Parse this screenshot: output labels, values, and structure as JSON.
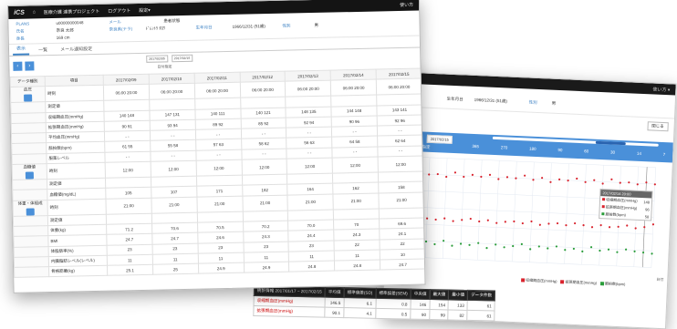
{
  "front": {
    "nav": {
      "logo": "iCS",
      "home_icon": "home-icon",
      "items": [
        "医療介護 連携プロジェクト",
        "ログアウト",
        "設定▾"
      ],
      "right": "使い方"
    },
    "patient": {
      "id_label": "PLANS",
      "id_value": "u00000000048",
      "name_label": "氏名",
      "name_value": "奈良 太郎",
      "h_label": "身長",
      "h_value": "169 cm",
      "kana_label": "メール",
      "kana_value": "奈良県(ナラ)",
      "kana2": "ﾄﾞﾚﾝﾄｳ ﾀﾛｳ",
      "status_label": "患者状態",
      "birth_label": "生年月日",
      "birth_value": "1966/12/31 (51歳)",
      "sex_label": "性別",
      "sex_value": "男"
    },
    "tabs": [
      "表示",
      "一覧",
      "メール通知設定"
    ],
    "ctrl": {
      "dates": [
        "2017/02/05",
        "2017/02/15"
      ],
      "caption": "日付指定"
    },
    "table": {
      "headers": [
        "データ種別",
        "項目",
        "2017/02/09",
        "2017/02/10",
        "2017/02/11",
        "2017/02/12",
        "2017/02/13",
        "2017/02/14",
        "2017/02/15"
      ],
      "rows": [
        {
          "sec": "血圧",
          "item": "時刻",
          "vals": [
            "06:00 20:00",
            "06:00 20:00",
            "06:00 20:00",
            "06:00 20:00",
            "06:00 20:00",
            "06:00 20:00",
            "06:00 20:00"
          ]
        },
        {
          "sec": "",
          "item": "測定値",
          "vals": [
            "",
            "",
            "",
            "",
            "",
            "",
            ""
          ]
        },
        {
          "sec": "",
          "item": "収縮期血圧(mmHg)",
          "vals": [
            "140 148",
            "147 131",
            "140 111",
            "140 121",
            "148 135",
            "144 148",
            "143 141"
          ]
        },
        {
          "sec": "",
          "item": "拡張期血圧(mmHg)",
          "vals": [
            "90 91",
            "93 94",
            "89 92",
            "85 92",
            "92 94",
            "90 96",
            "92 96"
          ]
        },
        {
          "sec": "",
          "item": "平均血圧(mmHg)",
          "vals": [
            "- -",
            "- -",
            "- -",
            "- -",
            "- -",
            "- -",
            "- -"
          ]
        },
        {
          "sec": "",
          "item": "脈拍数(bpm)",
          "vals": [
            "61 55",
            "55 58",
            "57 63",
            "58 62",
            "56 63",
            "64 58",
            "62 64"
          ]
        },
        {
          "sec": "",
          "item": "服薬レベル",
          "vals": [
            "- -",
            "- -",
            "- -",
            "- -",
            "- -",
            "- -",
            "- -"
          ]
        },
        {
          "sec": "血糖値",
          "item": "時刻",
          "vals": [
            "12:00",
            "12:00",
            "12:00",
            "12:00",
            "12:00",
            "12:00",
            "12:00"
          ]
        },
        {
          "sec": "",
          "item": "測定値",
          "vals": [
            "",
            "",
            "",
            "",
            "",
            "",
            ""
          ]
        },
        {
          "sec": "",
          "item": "血糖値(mg/dL)",
          "vals": [
            "105",
            "107",
            "171",
            "182",
            "164",
            "162",
            "158"
          ]
        },
        {
          "sec": "体重・体組成",
          "item": "時刻",
          "vals": [
            "21:00",
            "21:00",
            "21:00",
            "21:00",
            "21:00",
            "21:00",
            "21:00"
          ]
        },
        {
          "sec": "",
          "item": "測定値",
          "vals": [
            "",
            "",
            "",
            "",
            "",
            "",
            ""
          ]
        },
        {
          "sec": "",
          "item": "体重(kg)",
          "vals": [
            "71.2",
            "70.6",
            "70.5",
            "70.2",
            "70.0",
            "70",
            "69.6"
          ]
        },
        {
          "sec": "",
          "item": "BMI",
          "vals": [
            "24.7",
            "24.7",
            "24.6",
            "24.3",
            "24.4",
            "24.3",
            "24.1"
          ]
        },
        {
          "sec": "",
          "item": "体脂肪率(%)",
          "vals": [
            "23",
            "23",
            "23",
            "23",
            "23",
            "22",
            "22"
          ]
        },
        {
          "sec": "",
          "item": "内臓脂肪レベル(レベル)",
          "vals": [
            "11",
            "11",
            "11",
            "11",
            "11",
            "11",
            "10"
          ]
        },
        {
          "sec": "",
          "item": "骨格筋量(kg)",
          "vals": [
            "25.1",
            "25",
            "24.9",
            "24.9",
            "24.8",
            "24.8",
            "24.7"
          ]
        }
      ]
    }
  },
  "back": {
    "topbar_right": "使い方 ▾",
    "info": {
      "status": "患者状態",
      "kana": "ﾄﾞﾚﾝﾄｳ ﾀﾛｳ",
      "birth_label": "生年月日",
      "birth_value": "1966/12/31 (51歳)",
      "sex_label": "性別",
      "sex_value": "男"
    },
    "close_label": "閉じる",
    "timeline": {
      "start": "2017/01/17",
      "end": "2017/02/15",
      "caption": "日付指定",
      "ticks": [
        "365",
        "270",
        "180",
        "90",
        "60",
        "30",
        "14",
        "7"
      ]
    },
    "tooltip": {
      "title": "2017/02/14 20:00",
      "rows": [
        {
          "label": "収縮期血圧(mmHg)",
          "value": "148",
          "color": "#d9232d"
        },
        {
          "label": "拡張期血圧(mmHg)",
          "value": "96",
          "color": "#d9232d"
        },
        {
          "label": "脈拍数(bpm)",
          "value": "58",
          "color": "#2a9d3a"
        }
      ]
    },
    "legend": [
      {
        "label": "収縮期血圧(mmHg)",
        "color": "#d9232d"
      },
      {
        "label": "拡張期血圧(mmHg)",
        "color": "#d9232d"
      },
      {
        "label": "脈拍数(bpm)",
        "color": "#2a9d3a"
      }
    ],
    "axis_label": "日付",
    "stats": {
      "headers": [
        "統計情報 2017/01/17 ~ 2017/02/15",
        "平均値",
        "標準偏差(SD)",
        "標準誤差(SEM)",
        "中央値",
        "最大値",
        "最小値",
        "データ件数"
      ],
      "rows": [
        [
          "収縮期血圧(mmHg)",
          "146.5",
          "6.1",
          "0.8",
          "146",
          "154",
          "133",
          "61"
        ],
        [
          "拡張期血圧(mmHg)",
          "90.1",
          "4.1",
          "0.5",
          "90",
          "99",
          "82",
          "61"
        ]
      ]
    }
  },
  "chart_data": {
    "type": "scatter",
    "series": [
      {
        "name": "収縮期血圧(mmHg)",
        "color": "#d9232d",
        "values": [
          147,
          150,
          145,
          151,
          148,
          149,
          146,
          152,
          147,
          150,
          148,
          151,
          146,
          149,
          148,
          152,
          147,
          150,
          145,
          149,
          148,
          151,
          147,
          150,
          146,
          152,
          148,
          149,
          147,
          150,
          148
        ]
      },
      {
        "name": "拡張期血圧(mmHg)",
        "color": "#d9232d",
        "values": [
          90,
          92,
          89,
          93,
          91,
          90,
          92,
          89,
          91,
          93,
          90,
          92,
          89,
          91,
          92,
          90,
          93,
          89,
          91,
          92,
          90,
          93,
          91,
          89,
          92,
          90,
          91,
          93,
          90,
          92,
          96
        ]
      },
      {
        "name": "脈拍数(bpm)",
        "color": "#2a9d3a",
        "values": [
          60,
          57,
          62,
          56,
          61,
          58,
          63,
          57,
          60,
          59,
          62,
          56,
          61,
          58,
          60,
          63,
          57,
          61,
          59,
          62,
          58,
          60,
          57,
          63,
          59,
          61,
          58,
          62,
          60,
          59,
          58
        ]
      }
    ],
    "ylim": [
      40,
      170
    ]
  }
}
